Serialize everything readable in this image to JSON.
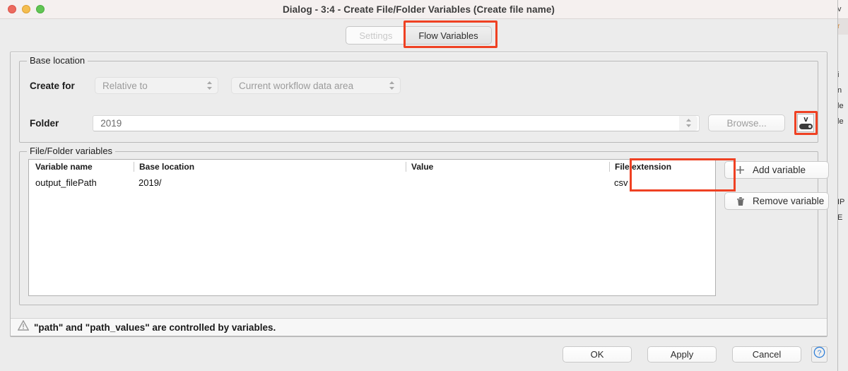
{
  "window": {
    "title": "Dialog - 3:4 - Create File/Folder Variables (Create file name)",
    "traffic_lights": [
      "close-button",
      "minimize-button",
      "zoom-button"
    ]
  },
  "tabs": [
    {
      "label": "Settings",
      "state": "inactive"
    },
    {
      "label": "Flow Variables",
      "state": "active",
      "highlighted": true
    }
  ],
  "base_location": {
    "group_title": "Base location",
    "create_for_label": "Create for",
    "relative_to_value": "Relative to",
    "data_area_value": "Current workflow data area",
    "folder_label": "Folder",
    "folder_value": "2019",
    "browse_label": "Browse...",
    "flow_variable_button_icon": "flow-variable-icon",
    "flow_variable_button_glyph": "v"
  },
  "file_folder_variables": {
    "group_title": "File/Folder variables",
    "columns": [
      "Variable name",
      "Base location",
      "Value",
      "File extension"
    ],
    "rows": [
      {
        "variable_name": "output_filePath",
        "base_location": "2019/",
        "value": "",
        "file_extension": "csv"
      }
    ],
    "add_label": "Add variable",
    "remove_label": "Remove variable",
    "add_icon": "plus-icon",
    "remove_icon": "trash-icon"
  },
  "warning": {
    "icon": "warning-triangle-icon",
    "text": "\"path\" and \"path_values\" are controlled by variables."
  },
  "footer": {
    "ok_label": "OK",
    "apply_label": "Apply",
    "cancel_label": "Cancel",
    "help_icon": "question-mark-icon",
    "help_glyph": "?"
  },
  "background_window": {
    "line1": "v",
    "tab_fragment": "r",
    "fragment_a": "i",
    "fragment_b": "n",
    "fragment_c": "le",
    "fragment_d": "le",
    "fragment_e": "IP",
    "fragment_f": "E"
  },
  "colors": {
    "highlight": "#ef4123",
    "window_bg": "#ececec",
    "titlebar_bg": "#f5f0ef",
    "help_blue": "#2f7fd8"
  }
}
